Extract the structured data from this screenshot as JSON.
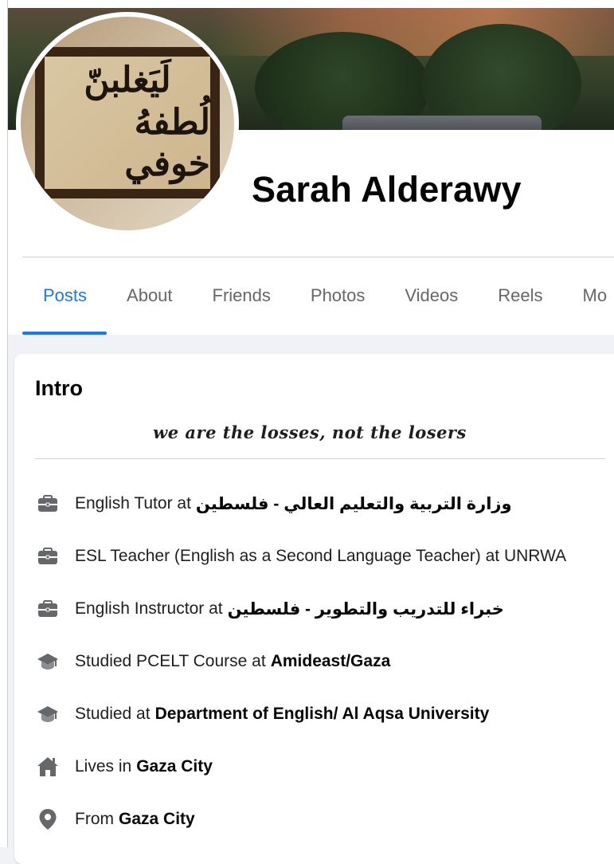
{
  "profile": {
    "name": "Sarah Alderawy",
    "avatar_text_line1": "لَيَغلبنّ",
    "avatar_text_line2": "لُطفهُ خوفي"
  },
  "tabs": [
    {
      "label": "Posts",
      "active": true
    },
    {
      "label": "About",
      "active": false
    },
    {
      "label": "Friends",
      "active": false
    },
    {
      "label": "Photos",
      "active": false
    },
    {
      "label": "Videos",
      "active": false
    },
    {
      "label": "Reels",
      "active": false
    },
    {
      "label": "Mo",
      "active": false
    }
  ],
  "intro": {
    "title": "Intro",
    "bio": "we are the losses, not the losers",
    "items": [
      {
        "icon": "briefcase-icon",
        "text": "English Tutor at",
        "strong": "وزارة التربية والتعليم العالي - فلسطين",
        "rtl": true
      },
      {
        "icon": "briefcase-icon",
        "text": "ESL Teacher (English as a Second Language Teacher) at UNRWA",
        "strong": "",
        "rtl": false
      },
      {
        "icon": "briefcase-icon",
        "text": "English Instructor at",
        "strong": "خبراء للتدريب والتطوير - فلسطين",
        "rtl": true
      },
      {
        "icon": "graduation-cap-icon",
        "text": "Studied PCELT Course at",
        "strong": "Amideast/Gaza",
        "rtl": false
      },
      {
        "icon": "graduation-cap-icon",
        "text": "Studied at",
        "strong": "Department of English/ Al Aqsa University",
        "rtl": false
      },
      {
        "icon": "home-icon",
        "text": "Lives in",
        "strong": "Gaza City",
        "rtl": false
      },
      {
        "icon": "location-pin-icon",
        "text": "From",
        "strong": "Gaza City",
        "rtl": false
      }
    ]
  },
  "colors": {
    "accent": "#1877f2",
    "text_secondary": "#65676b",
    "icon_gray": "#65676b",
    "page_bg": "#f0f2f5"
  }
}
